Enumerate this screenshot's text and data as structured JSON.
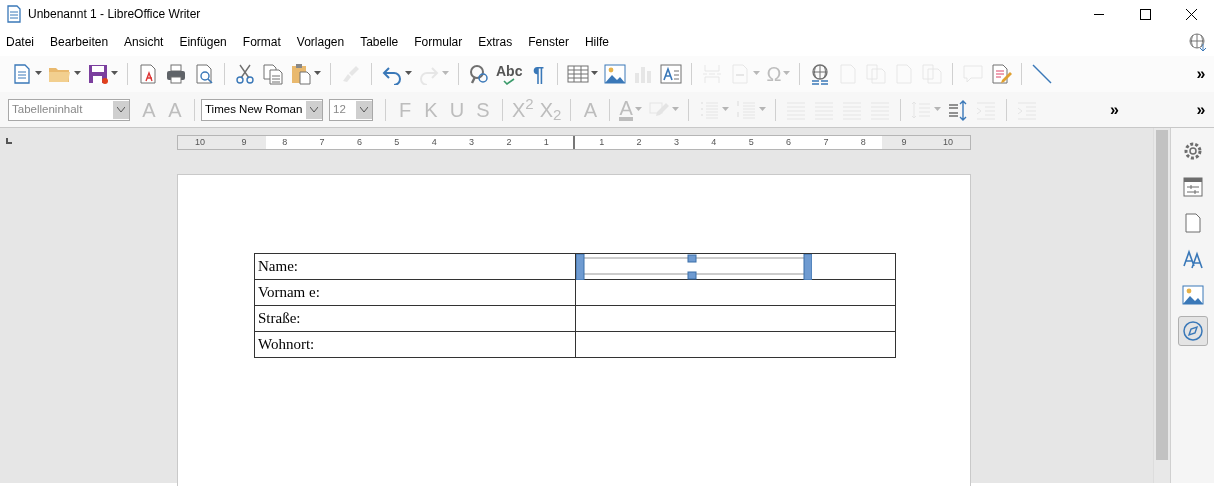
{
  "window": {
    "title": "Unbenannt 1 - LibreOffice Writer"
  },
  "menu": [
    {
      "label": "Datei"
    },
    {
      "label": "Bearbeiten"
    },
    {
      "label": "Ansicht"
    },
    {
      "label": "Einfügen"
    },
    {
      "label": "Format"
    },
    {
      "label": "Vorlagen"
    },
    {
      "label": "Tabelle"
    },
    {
      "label": "Formular"
    },
    {
      "label": "Extras"
    },
    {
      "label": "Fenster"
    },
    {
      "label": "Hilfe"
    }
  ],
  "standard_toolbar": [
    {
      "kind": "new",
      "caret": true,
      "disabled": false
    },
    {
      "kind": "open",
      "caret": true,
      "disabled": false
    },
    {
      "kind": "save",
      "caret": true,
      "disabled": false
    },
    {
      "kind": "sep"
    },
    {
      "kind": "pdf",
      "caret": false,
      "disabled": false
    },
    {
      "kind": "print",
      "caret": false,
      "disabled": false
    },
    {
      "kind": "preview",
      "caret": false,
      "disabled": false
    },
    {
      "kind": "sep"
    },
    {
      "kind": "cut",
      "caret": false,
      "disabled": false
    },
    {
      "kind": "copy",
      "caret": false,
      "disabled": false
    },
    {
      "kind": "paste",
      "caret": true,
      "disabled": false
    },
    {
      "kind": "sep"
    },
    {
      "kind": "brush",
      "caret": false,
      "disabled": true
    },
    {
      "kind": "sep"
    },
    {
      "kind": "undo",
      "caret": true,
      "disabled": false
    },
    {
      "kind": "redo",
      "caret": true,
      "disabled": true
    },
    {
      "kind": "sep"
    },
    {
      "kind": "find",
      "caret": false,
      "disabled": false
    },
    {
      "kind": "spell",
      "label": "Abc",
      "caret": false,
      "disabled": false
    },
    {
      "kind": "glyph",
      "label": "¶",
      "caret": false,
      "disabled": false
    },
    {
      "kind": "sep"
    },
    {
      "kind": "table",
      "caret": true,
      "disabled": false
    },
    {
      "kind": "image",
      "caret": false,
      "disabled": false
    },
    {
      "kind": "chart",
      "caret": false,
      "disabled": true
    },
    {
      "kind": "textbox",
      "caret": false,
      "disabled": false
    },
    {
      "kind": "sep"
    },
    {
      "kind": "pagebreak",
      "caret": false,
      "disabled": true
    },
    {
      "kind": "field",
      "caret": true,
      "disabled": true
    },
    {
      "kind": "glyph",
      "label": "Ω",
      "caret": true,
      "disabled": true
    },
    {
      "kind": "sep"
    },
    {
      "kind": "hyperlink",
      "caret": false,
      "disabled": false
    },
    {
      "kind": "page",
      "caret": false,
      "disabled": true
    },
    {
      "kind": "pages",
      "caret": false,
      "disabled": true
    },
    {
      "kind": "page",
      "caret": false,
      "disabled": true
    },
    {
      "kind": "pages",
      "caret": false,
      "disabled": true
    },
    {
      "kind": "sep"
    },
    {
      "kind": "comment",
      "caret": false,
      "disabled": true
    },
    {
      "kind": "track",
      "caret": false,
      "disabled": false
    },
    {
      "kind": "sep"
    },
    {
      "kind": "line",
      "caret": false,
      "disabled": false
    },
    {
      "kind": "more",
      "label": "»",
      "caret": false,
      "disabled": false
    }
  ],
  "formatting_toolbar": [
    {
      "kind": "style_box",
      "value": "Tabelleninhalt",
      "disabled": true
    },
    {
      "kind": "glyph",
      "label": "A",
      "caret": false,
      "disabled": true
    },
    {
      "kind": "glyph",
      "label": "A",
      "caret": false,
      "disabled": true
    },
    {
      "kind": "sep"
    },
    {
      "kind": "font_box",
      "value": "Times New Roman",
      "disabled": false
    },
    {
      "kind": "size_box",
      "value": "12",
      "disabled": true
    },
    {
      "kind": "sep"
    },
    {
      "kind": "glyph",
      "label": "F",
      "caret": false,
      "disabled": true
    },
    {
      "kind": "glyph",
      "label": "K",
      "caret": false,
      "disabled": true
    },
    {
      "kind": "glyph",
      "label": "U",
      "caret": false,
      "disabled": true
    },
    {
      "kind": "glyph",
      "label": "S",
      "caret": false,
      "disabled": true
    },
    {
      "kind": "sep"
    },
    {
      "kind": "glyph",
      "label": "X$^{2}$",
      "caret": false,
      "disabled": true
    },
    {
      "kind": "glyph",
      "label": "X$_{2}$",
      "caret": false,
      "disabled": true
    },
    {
      "kind": "sep"
    },
    {
      "kind": "glyph",
      "label": "A",
      "caret": false,
      "disabled": true
    },
    {
      "kind": "sep"
    },
    {
      "kind": "fontcolor",
      "label": "A",
      "caret": true,
      "disabled": true
    },
    {
      "kind": "highlight",
      "caret": true,
      "disabled": true
    },
    {
      "kind": "sep"
    },
    {
      "kind": "bullets",
      "caret": true,
      "disabled": true
    },
    {
      "kind": "numbering",
      "caret": true,
      "disabled": true
    },
    {
      "kind": "sep"
    },
    {
      "kind": "align",
      "caret": false,
      "disabled": true
    },
    {
      "kind": "align",
      "caret": false,
      "disabled": true
    },
    {
      "kind": "align",
      "caret": false,
      "disabled": true
    },
    {
      "kind": "align",
      "caret": false,
      "disabled": true
    },
    {
      "kind": "sep"
    },
    {
      "kind": "linespacing",
      "caret": true,
      "disabled": true
    },
    {
      "kind": "paraspacing",
      "caret": false,
      "disabled": false
    },
    {
      "kind": "indent",
      "caret": false,
      "disabled": true
    },
    {
      "kind": "sep"
    },
    {
      "kind": "indent",
      "caret": false,
      "disabled": true
    },
    {
      "kind": "more",
      "label": "»",
      "caret": false,
      "disabled": false
    },
    {
      "kind": "more",
      "label": "»",
      "caret": false,
      "disabled": false
    }
  ],
  "ruler": {
    "left_labels": [
      "10",
      "9",
      "8",
      "7",
      "6",
      "5",
      "4",
      "3",
      "2",
      "1"
    ],
    "right_labels": [
      "1",
      "2",
      "3",
      "4",
      "5",
      "6",
      "7",
      "8",
      "9",
      "10"
    ]
  },
  "table": {
    "rows": [
      {
        "label": "Name:",
        "value_selected": true
      },
      {
        "label": "Vornam e:",
        "value_selected": false
      },
      {
        "label": "Straße:",
        "value_selected": false
      },
      {
        "label": "Wohnort:",
        "value_selected": false
      }
    ]
  },
  "sidebar": [
    {
      "kind": "settings",
      "selected": false
    },
    {
      "kind": "properties",
      "selected": false
    },
    {
      "kind": "page",
      "selected": false
    },
    {
      "kind": "styles",
      "selected": false
    },
    {
      "kind": "gallery",
      "selected": false
    },
    {
      "kind": "navigator",
      "selected": true
    }
  ]
}
